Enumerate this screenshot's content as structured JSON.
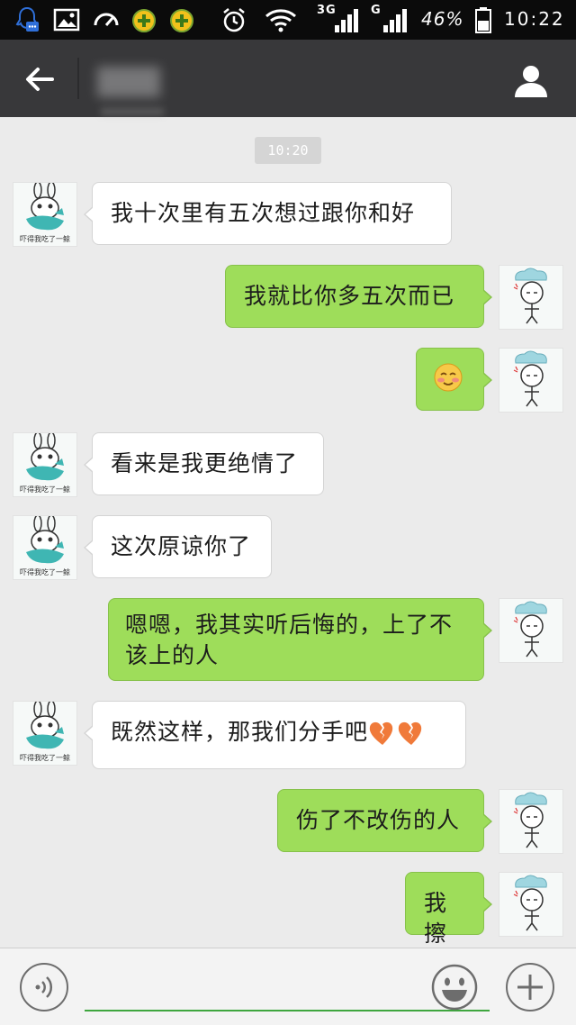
{
  "status_bar": {
    "network_1": "3G",
    "network_2": "G",
    "battery": "46%",
    "time": "10:22"
  },
  "header": {
    "back_icon": "arrow-left-icon",
    "profile_icon": "person-icon"
  },
  "chat": {
    "timestamp": "10:20",
    "messages": [
      {
        "side": "in",
        "text": "我十次里有五次想过跟你和好"
      },
      {
        "side": "out",
        "text": "我就比你多五次而已"
      },
      {
        "side": "out",
        "text": "",
        "emoji": "smile-blush-emoji"
      },
      {
        "side": "in",
        "text": "看来是我更绝情了"
      },
      {
        "side": "in",
        "text": "这次原谅你了"
      },
      {
        "side": "out",
        "text": "嗯嗯，我其实听后悔的，上了不该上的人"
      },
      {
        "side": "in",
        "text": "既然这样，那我们分手吧",
        "emoji": "broken-heart-emoji"
      },
      {
        "side": "out",
        "text": "伤了不改伤的人"
      },
      {
        "side": "out",
        "text": "我擦"
      }
    ],
    "sender_avatar_caption": "吓得我吃了一鲸"
  },
  "input_bar": {
    "voice_icon": "voice-icon",
    "emoji_icon": "emoji-icon",
    "plus_icon": "plus-icon"
  },
  "colors": {
    "status_bar": "#0b0b0b",
    "title_bar": "#38383a",
    "chat_bg": "#ebebeb",
    "bubble_out": "#9edd5a",
    "bubble_in": "#ffffff",
    "input_line": "#3ea63e"
  }
}
